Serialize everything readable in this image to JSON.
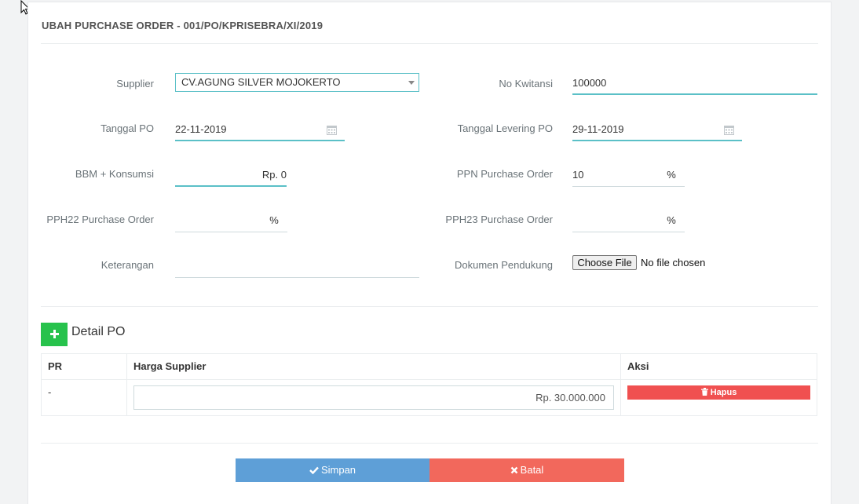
{
  "title": "UBAH PURCHASE ORDER - 001/PO/KPRISEBRA/XI/2019",
  "form": {
    "supplier": {
      "label": "Supplier",
      "value": "CV.AGUNG SILVER MOJOKERTO"
    },
    "no_kwitansi": {
      "label": "No Kwitansi",
      "value": "100000"
    },
    "tanggal_po": {
      "label": "Tanggal PO",
      "value": "22-11-2019"
    },
    "tanggal_levering": {
      "label": "Tanggal Levering PO",
      "value": "29-11-2019"
    },
    "bbm_konsumsi": {
      "label": "BBM + Konsumsi",
      "value": "Rp. 0"
    },
    "ppn": {
      "label": "PPN Purchase Order",
      "value": "10",
      "unit": "%"
    },
    "pph22": {
      "label": "PPH22 Purchase Order",
      "value": "",
      "unit": "%"
    },
    "pph23": {
      "label": "PPH23 Purchase Order",
      "value": "",
      "unit": "%"
    },
    "keterangan": {
      "label": "Keterangan",
      "value": ""
    },
    "dokumen": {
      "label": "Dokumen Pendukung",
      "button": "Choose File",
      "status": "No file chosen"
    }
  },
  "detail": {
    "title": "Detail PO",
    "columns": [
      "PR",
      "Harga Supplier",
      "Aksi"
    ],
    "rows": [
      {
        "pr": "-",
        "harga": "Rp. 30.000.000",
        "action": "Hapus"
      }
    ]
  },
  "actions": {
    "save": "Simpan",
    "cancel": "Batal"
  },
  "colors": {
    "accent": "#5bc0c7",
    "save": "#5e9fd7",
    "cancel": "#f2685c",
    "add": "#27c24c",
    "delete": "#f05050"
  },
  "icons": [
    "calendar-icon",
    "plus-icon",
    "trash-icon",
    "check-icon",
    "times-icon",
    "cursor-icon"
  ]
}
